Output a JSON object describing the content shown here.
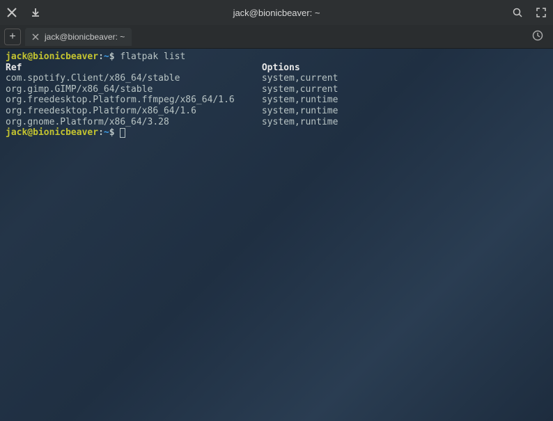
{
  "window": {
    "title": "jack@bionicbeaver: ~"
  },
  "tab": {
    "label": "jack@bionicbeaver: ~"
  },
  "prompt": {
    "user_host": "jack@bionicbeaver",
    "separator": ":",
    "path": "~",
    "symbol": "$"
  },
  "command": "flatpak list",
  "headers": {
    "ref": "Ref",
    "options": "Options"
  },
  "rows": [
    {
      "ref": "com.spotify.Client/x86_64/stable",
      "options": "system,current"
    },
    {
      "ref": "org.gimp.GIMP/x86_64/stable",
      "options": "system,current"
    },
    {
      "ref": "org.freedesktop.Platform.ffmpeg/x86_64/1.6",
      "options": "system,runtime"
    },
    {
      "ref": "org.freedesktop.Platform/x86_64/1.6",
      "options": "system,runtime"
    },
    {
      "ref": "org.gnome.Platform/x86_64/3.28",
      "options": "system,runtime"
    }
  ],
  "layout": {
    "ref_col_width": 47
  }
}
